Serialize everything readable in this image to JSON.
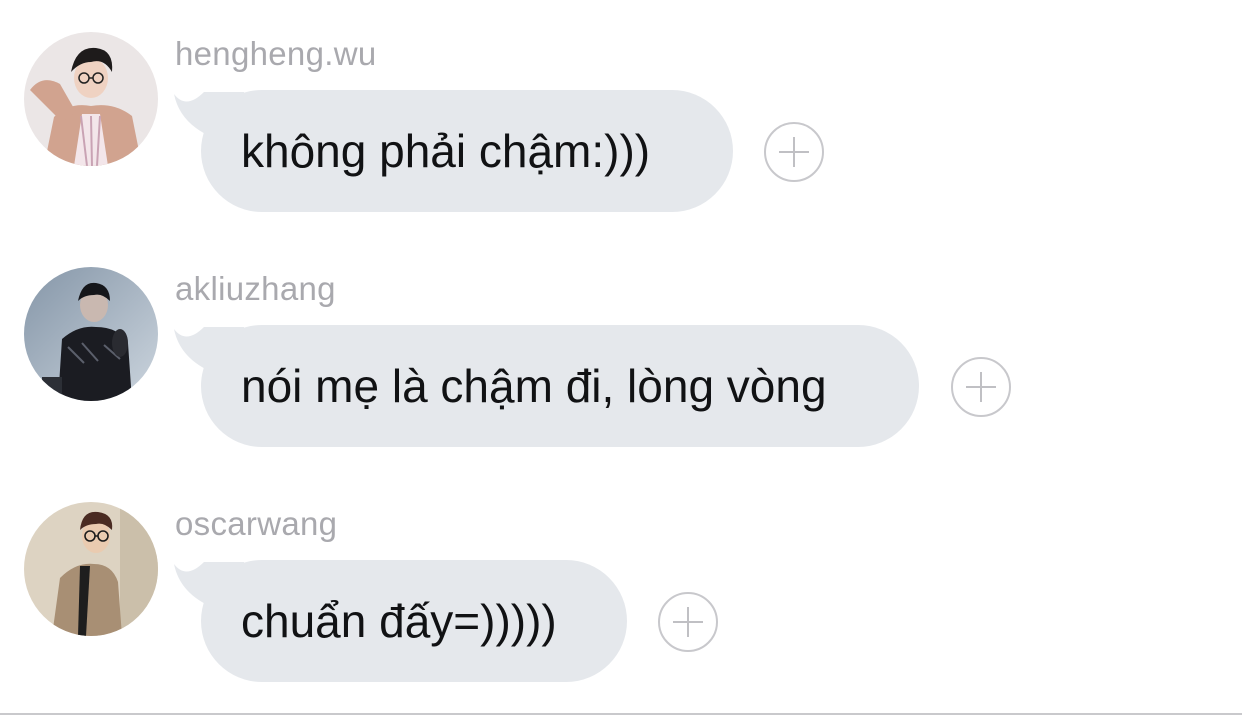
{
  "messages": [
    {
      "username": "hengheng.wu",
      "text": "không phải chậm:)))",
      "avatar_icon": "profile-photo-person-glasses-beige-shirt"
    },
    {
      "username": "akliuzhang",
      "text": "nói mẹ là chậm đi, lòng vòng",
      "avatar_icon": "profile-photo-person-dark-outfit"
    },
    {
      "username": "oscarwang",
      "text": "chuẩn đấy=)))))",
      "avatar_icon": "profile-photo-person-glasses-camel-coat"
    }
  ],
  "colors": {
    "bubble": "#e5e8ec",
    "username": "#a9a9ae",
    "message_text": "#111214",
    "react_button_border": "#c8c8cc"
  }
}
